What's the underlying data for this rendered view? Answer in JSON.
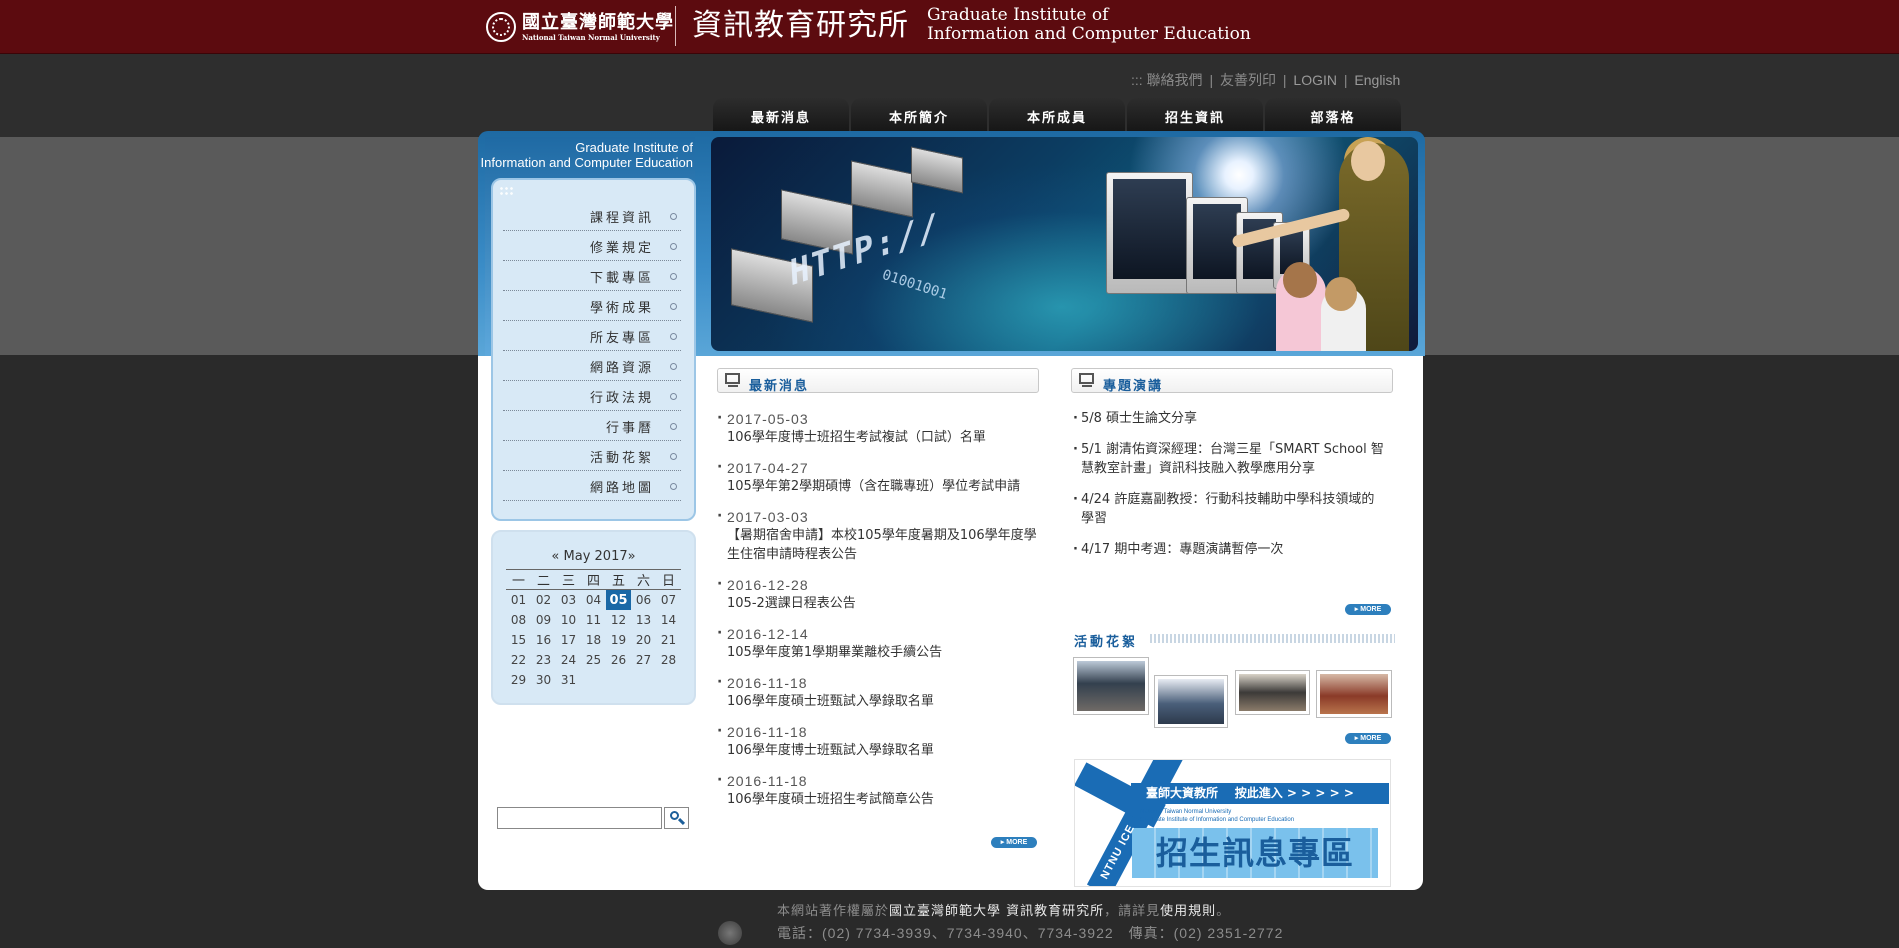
{
  "header": {
    "university_zh": "國立臺灣師範大學",
    "university_en": "National Taiwan Normal University",
    "institute_zh": "資訊教育研究所",
    "institute_en_line1": "Graduate Institute of",
    "institute_en_line2": "Information and Computer Education"
  },
  "utility_links": {
    "prefix": ":::",
    "contact": "聯絡我們",
    "print": "友善列印",
    "login": "LOGIN",
    "english": "English",
    "separator": "|"
  },
  "nav": [
    "最新消息",
    "本所簡介",
    "本所成員",
    "招生資訊",
    "部落格"
  ],
  "sidebar": {
    "title_line1": "Graduate Institute of",
    "title_line2": "Information and Computer Education",
    "menu": [
      "課程資訊",
      "修業規定",
      "下載專區",
      "學術成果",
      "所友專區",
      "網路資源",
      "行政法規",
      "行事曆",
      "活動花絮",
      "網路地圖"
    ]
  },
  "calendar": {
    "prev": "«",
    "month_label": "May 2017",
    "next": "»",
    "weekdays": [
      "一",
      "二",
      "三",
      "四",
      "五",
      "六",
      "日"
    ],
    "weeks": [
      [
        "01",
        "02",
        "03",
        "04",
        "05",
        "06",
        "07"
      ],
      [
        "08",
        "09",
        "10",
        "11",
        "12",
        "13",
        "14"
      ],
      [
        "15",
        "16",
        "17",
        "18",
        "19",
        "20",
        "21"
      ],
      [
        "22",
        "23",
        "24",
        "25",
        "26",
        "27",
        "28"
      ],
      [
        "29",
        "30",
        "31",
        "",
        "",
        "",
        ""
      ]
    ],
    "today": "05"
  },
  "search": {
    "placeholder": ""
  },
  "banner": {
    "http_text": "HTTP://",
    "binary_text": "01001001"
  },
  "news": {
    "title": "最新消息",
    "more": "MORE",
    "items": [
      {
        "date": "2017-05-03",
        "title": "106學年度博士班招生考試複試（口試）名單"
      },
      {
        "date": "2017-04-27",
        "title": "105學年第2學期碩博（含在職專班）學位考試申請"
      },
      {
        "date": "2017-03-03",
        "title": "【暑期宿舍申請】本校105學年度暑期及106學年度學生住宿申請時程表公告"
      },
      {
        "date": "2016-12-28",
        "title": "105-2選課日程表公告"
      },
      {
        "date": "2016-12-14",
        "title": "105學年度第1學期畢業離校手續公告"
      },
      {
        "date": "2016-11-18",
        "title": "106學年度碩士班甄試入學錄取名單"
      },
      {
        "date": "2016-11-18",
        "title": "106學年度博士班甄試入學錄取名單"
      },
      {
        "date": "2016-11-18",
        "title": "106學年度碩士班招生考試簡章公告"
      }
    ]
  },
  "talks": {
    "title": "專題演講",
    "more": "MORE",
    "items": [
      "5/8 碩士生論文分享",
      "5/1 謝清佑資深經理：台灣三星「SMART School 智慧教室計畫」資訊科技融入教學應用分享",
      "4/24 許庭嘉副教授：行動科技輔助中學科技領域的學習",
      "4/17 期中考週：專題演講暫停一次"
    ]
  },
  "activities": {
    "title": "活動花絮",
    "more": "MORE"
  },
  "admissions": {
    "strip": "臺師大資教所    按此進入 > > > > >",
    "small_line1": "National Taiwan Normal University",
    "small_line2": "Graduate Institute of Information and Computer Education",
    "big": "招生訊息專區",
    "vertical": "NTNU ICE"
  },
  "footer": {
    "line1_a": "本網站著作權屬於",
    "line1_b": "國立臺灣師範大學 資訊教育研究所",
    "line1_c": "，請詳見",
    "line1_d": "使用規則",
    "line1_e": "。",
    "line2": "電話：(02) 7734-3939、7734-3940、7734-3922　傳真：(02) 2351-2772"
  },
  "colors": {
    "header_bg": "#5c0b0f",
    "accent_blue": "#1a68a6",
    "page_bg": "#262626"
  }
}
